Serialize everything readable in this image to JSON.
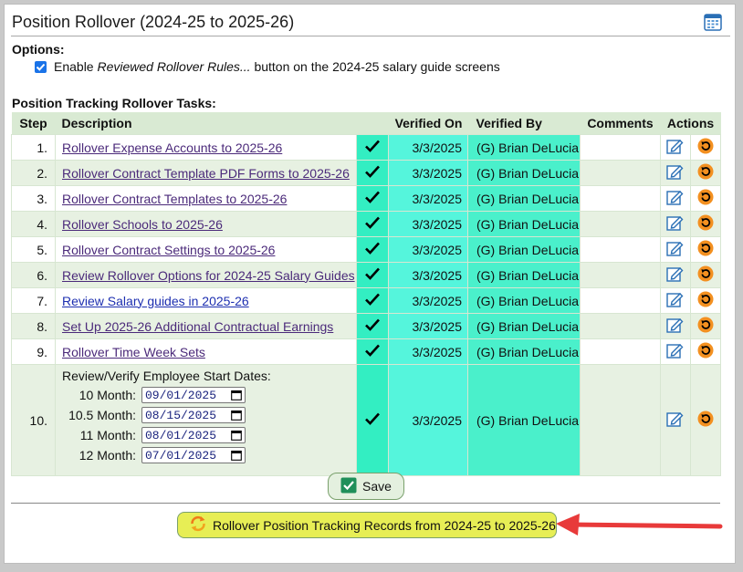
{
  "header": {
    "title": "Position Rollover (2024-25 to 2025-26)",
    "calendar_icon": "calendar-icon"
  },
  "options": {
    "label": "Options:",
    "checkbox_checked": true,
    "text_italic": "Reviewed Rollover Rules...",
    "text_prefix": "Enable ",
    "text_suffix": " button on the 2024-25 salary guide screens"
  },
  "tasks_label": "Position Tracking Rollover Tasks:",
  "table": {
    "headers": [
      "Step",
      "Description",
      "Verified On",
      "Verified By",
      "Comments",
      "Actions"
    ],
    "rows": [
      {
        "step": "1.",
        "desc": "Rollover Expense Accounts to 2025-26",
        "verified_on": "3/3/2025",
        "verified_by": "(G) Brian DeLucia"
      },
      {
        "step": "2.",
        "desc": "Rollover Contract Template PDF Forms to 2025-26",
        "verified_on": "3/3/2025",
        "verified_by": "(G) Brian DeLucia"
      },
      {
        "step": "3.",
        "desc": "Rollover Contract Templates to 2025-26",
        "verified_on": "3/3/2025",
        "verified_by": "(G) Brian DeLucia"
      },
      {
        "step": "4.",
        "desc": "Rollover Schools to 2025-26",
        "verified_on": "3/3/2025",
        "verified_by": "(G) Brian DeLucia"
      },
      {
        "step": "5.",
        "desc": "Rollover Contract Settings to 2025-26",
        "verified_on": "3/3/2025",
        "verified_by": "(G) Brian DeLucia"
      },
      {
        "step": "6.",
        "desc": "Review Rollover Options for 2024-25 Salary Guides",
        "verified_on": "3/3/2025",
        "verified_by": "(G) Brian DeLucia"
      },
      {
        "step": "7.",
        "desc": "Review Salary guides in 2025-26",
        "verified_on": "3/3/2025",
        "verified_by": "(G) Brian DeLucia"
      },
      {
        "step": "8.",
        "desc": "Set Up 2025-26 Additional Contractual Earnings",
        "verified_on": "3/3/2025",
        "verified_by": "(G) Brian DeLucia"
      },
      {
        "step": "9.",
        "desc": "Rollover Time Week Sets",
        "verified_on": "3/3/2025",
        "verified_by": "(G) Brian DeLucia"
      }
    ],
    "row10": {
      "step": "10.",
      "desc": "Review/Verify Employee Start Dates:",
      "dates": [
        {
          "label": "10 Month:",
          "value": "09/01/2025"
        },
        {
          "label": "10.5 Month:",
          "value": "08/15/2025"
        },
        {
          "label": "11 Month:",
          "value": "08/01/2025"
        },
        {
          "label": "12 Month:",
          "value": "07/01/2025"
        }
      ],
      "verified_on": "3/3/2025",
      "verified_by": "(G) Brian DeLucia"
    }
  },
  "save_label": "Save",
  "rollover_label": "Rollover Position Tracking Records from 2024-25 to 2025-26",
  "colors": {
    "accent_green": "#d9ead3",
    "verified_teal": "#4af0cb",
    "rollover_yellow": "#e7ee55",
    "arrow_red": "#e83a3a"
  }
}
